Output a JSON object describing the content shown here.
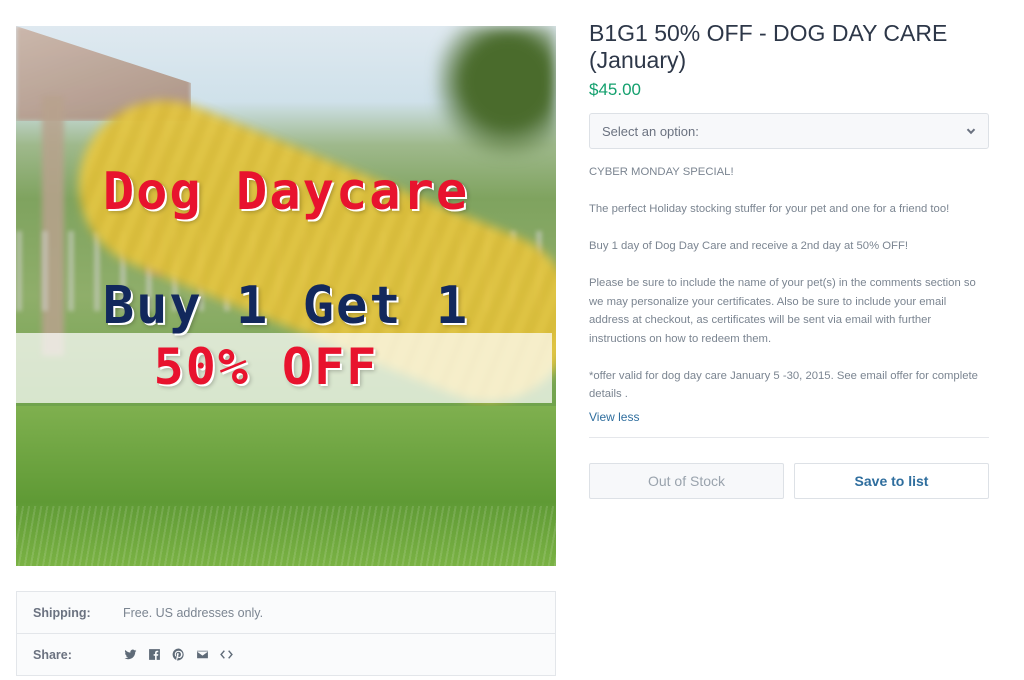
{
  "hero": {
    "line1": "Dog Daycare",
    "line2": "Buy 1 Get 1",
    "line3": "50% OFF"
  },
  "info": {
    "shipping_label": "Shipping:",
    "shipping_value": "Free. US addresses only.",
    "share_label": "Share:",
    "share_icons": [
      "twitter-icon",
      "facebook-icon",
      "pinterest-icon",
      "email-icon",
      "embed-icon"
    ]
  },
  "product": {
    "title": "B1G1 50% OFF - DOG DAY CARE (January)",
    "price": "$45.00",
    "select_placeholder": "Select an option:",
    "description": [
      "CYBER MONDAY SPECIAL!",
      "The perfect Holiday stocking stuffer for your pet and one for a friend too!",
      "Buy 1 day of Dog Day Care and receive a 2nd day at 50% OFF!",
      "Please be sure to include the name of your pet(s) in the comments section so we may personalize your certificates. Also be sure to include your email address at checkout, as certificates will be sent via email with further instructions on how to redeem them.",
      "*offer valid for dog day care January 5 -30, 2015. See email offer for complete details ."
    ],
    "view_less": "View less",
    "out_of_stock": "Out of Stock",
    "save_to_list": "Save to list"
  },
  "colors": {
    "price": "#14a06e",
    "link": "#2f6e9e",
    "hero_red": "#e8132e",
    "hero_navy": "#12285c"
  }
}
